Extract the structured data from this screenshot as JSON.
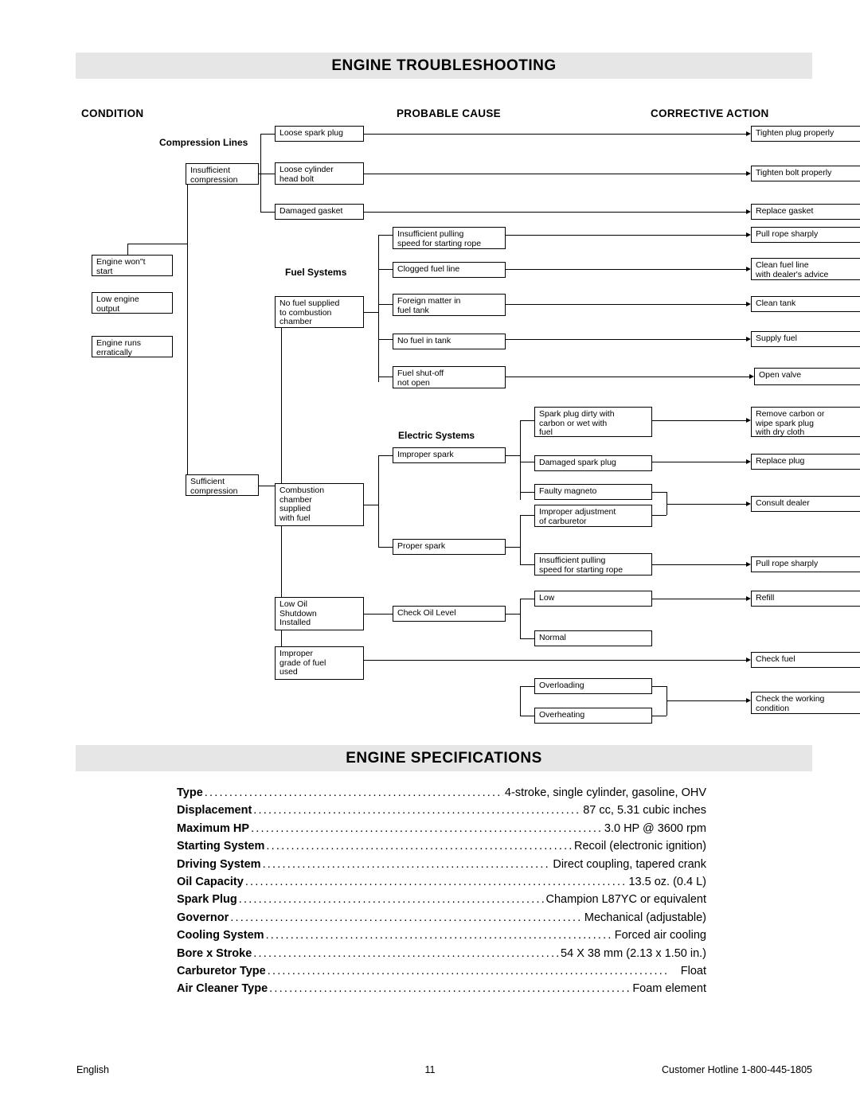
{
  "sections": {
    "troubleshooting_title": "ENGINE TROUBLESHOOTING",
    "specs_title": "ENGINE SPECIFICATIONS"
  },
  "diagram": {
    "columns": {
      "condition": "CONDITION",
      "probable_cause": "PROBABLE CAUSE",
      "corrective_action": "CORRECTIVE ACTION"
    },
    "group_labels": {
      "compression": "Compression Lines",
      "fuel": "Fuel Systems",
      "electric": "Electric Systems"
    },
    "conditions": [
      "Engine won\"t\nstart",
      "Low engine\noutput",
      "Engine runs\nerratically"
    ],
    "branches": [
      "Insufficient\ncompression",
      "Sufficient\ncompression"
    ],
    "causes": {
      "loose_spark_plug": "Loose spark plug",
      "loose_cylinder_head_bolt": "Loose cylinder\nhead bolt",
      "damaged_gasket": "Damaged gasket",
      "insufficient_pulling_speed": "Insufficient pulling\nspeed for starting rope",
      "clogged_fuel_line": "Clogged fuel line",
      "foreign_matter": "Foreign matter in\nfuel tank",
      "no_fuel_in_tank": "No fuel in tank",
      "fuel_shutoff": "Fuel shut-off\nnot open",
      "no_fuel_supplied": "No fuel supplied\nto combustion\nchamber",
      "combustion_chamber_supplied": "Combustion\nchamber\nsupplied\nwith fuel",
      "improper_spark": "Improper spark",
      "proper_spark": "Proper spark",
      "spark_plug_dirty": "Spark plug dirty with\ncarbon or wet with\nfuel",
      "damaged_spark_plug": "Damaged spark plug",
      "faulty_magneto": "Faulty magneto",
      "improper_adjustment": "Improper adjustment\nof carburetor",
      "insufficient_pulling_speed2": "Insufficient pulling\nspeed for starting rope",
      "low_oil_shutdown": "Low Oil\nShutdown\nInstalled",
      "check_oil_level": "Check Oil Level",
      "low": "Low",
      "normal": "Normal",
      "improper_grade_fuel": "Improper\ngrade of fuel\nused",
      "overloading": "Overloading",
      "overheating": "Overheating"
    },
    "actions": {
      "tighten_plug": "Tighten plug properly",
      "tighten_bolt": "Tighten bolt properly",
      "replace_gasket": "Replace gasket",
      "pull_rope_sharply": "Pull rope sharply",
      "clean_fuel_line": "Clean fuel line\nwith dealer's advice",
      "clean_tank": "Clean tank",
      "supply_fuel": "Supply fuel",
      "open_valve": "Open valve",
      "remove_carbon": "Remove carbon or\nwipe spark plug\nwith dry cloth",
      "replace_plug": "Replace plug",
      "consult_dealer": "Consult dealer",
      "pull_rope_sharply2": "Pull rope sharply",
      "refill": "Refill",
      "check_fuel": "Check fuel",
      "check_working_condition": "Check the working\ncondition"
    }
  },
  "specs": [
    {
      "label": "Type",
      "value": "4-stroke, single cylinder, gasoline, OHV"
    },
    {
      "label": "Displacement",
      "value": "87 cc, 5.31 cubic inches"
    },
    {
      "label": "Maximum HP",
      "value": "3.0 HP @ 3600 rpm"
    },
    {
      "label": "Starting System",
      "value": "Recoil (electronic ignition)"
    },
    {
      "label": "Driving System",
      "value": "Direct coupling, tapered crank"
    },
    {
      "label": "Oil Capacity",
      "value": "13.5 oz. (0.4 L)"
    },
    {
      "label": "Spark Plug",
      "value": "Champion L87YC or equivalent"
    },
    {
      "label": "Governor",
      "value": "Mechanical (adjustable)"
    },
    {
      "label": "Cooling System",
      "value": "Forced air cooling"
    },
    {
      "label": "Bore x Stroke",
      "value": "54 X 38 mm (2.13 x 1.50 in.)"
    },
    {
      "label": "Carburetor Type",
      "value": "Float"
    },
    {
      "label": "Air Cleaner Type",
      "value": "Foam element"
    }
  ],
  "footer": {
    "language": "English",
    "page_number": "11",
    "hotline": "Customer Hotline 1-800-445-1805"
  }
}
